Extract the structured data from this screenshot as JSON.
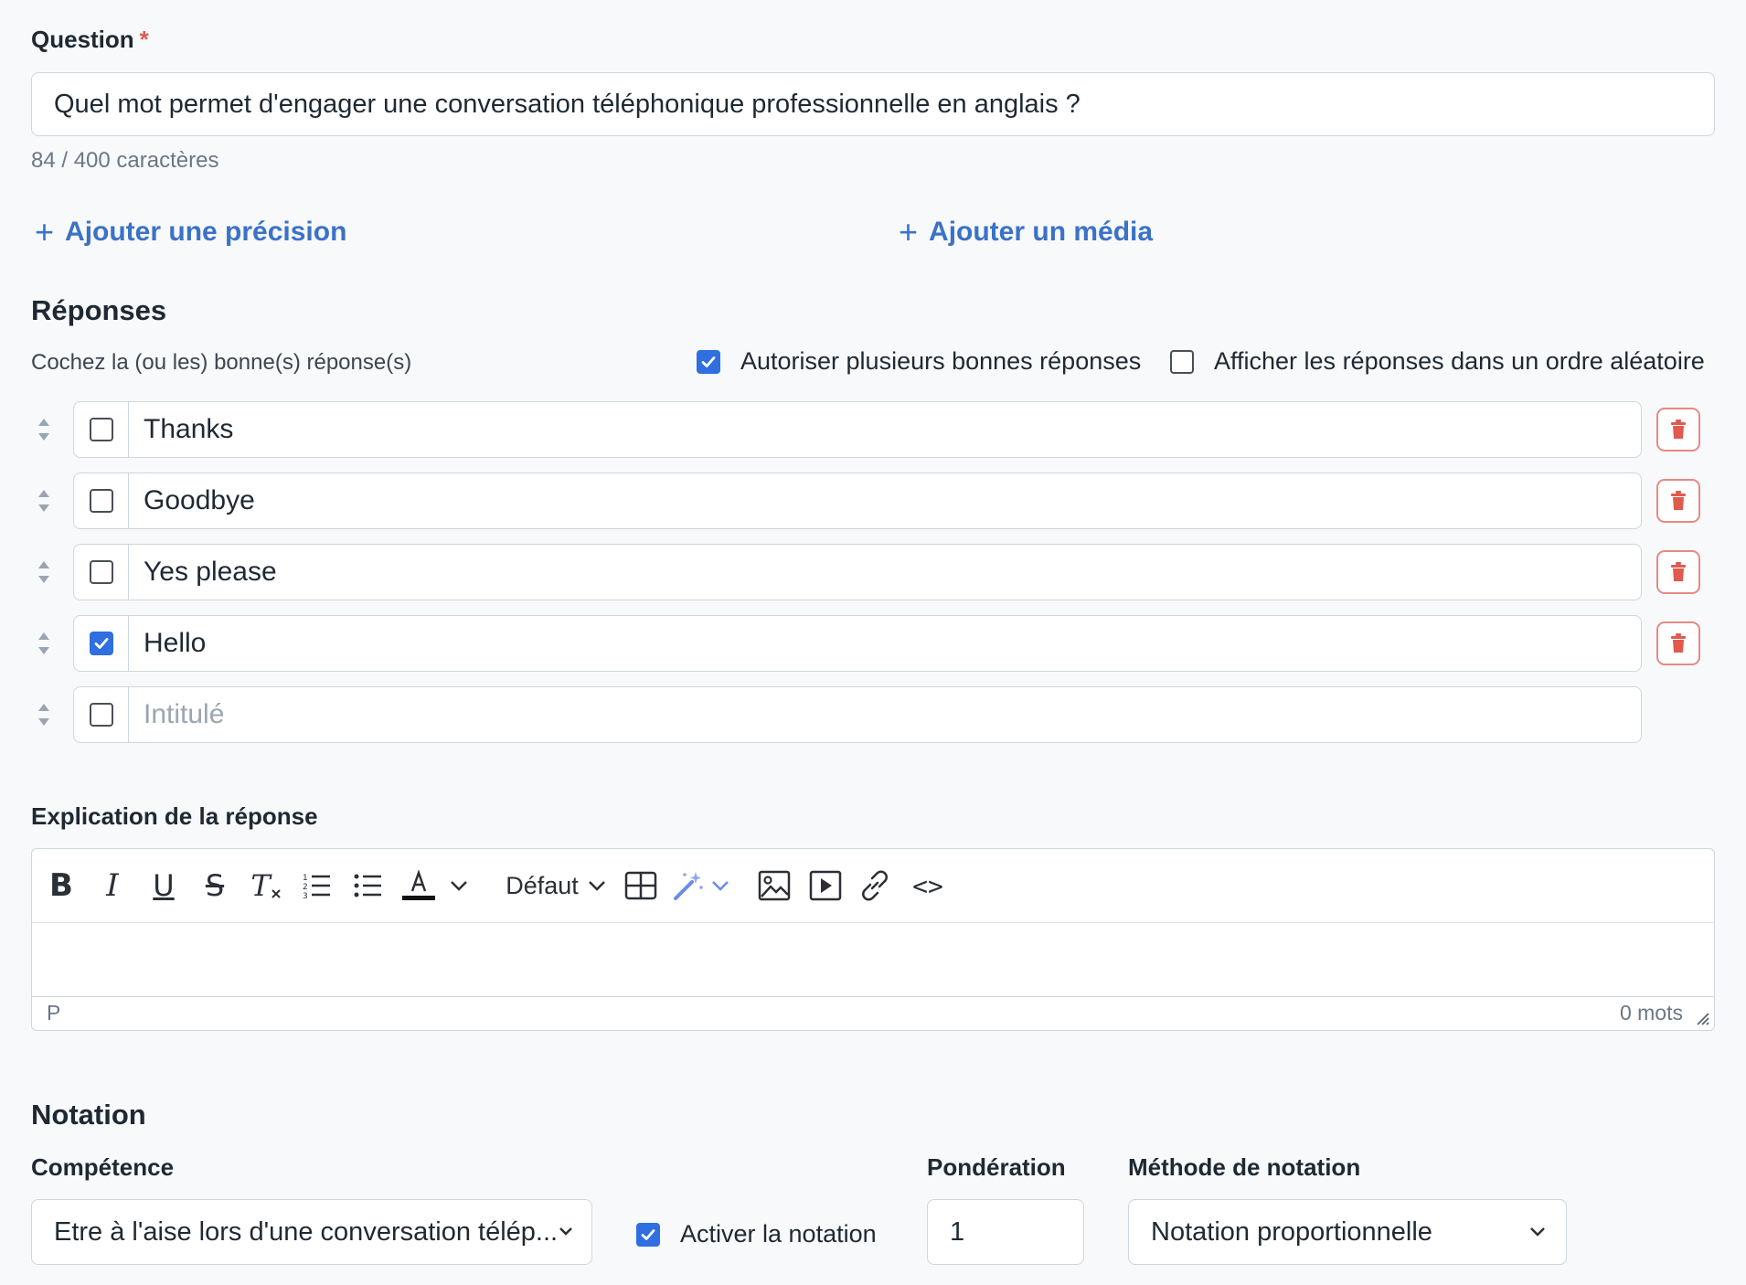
{
  "question": {
    "label": "Question",
    "required_mark": "*",
    "value": "Quel mot permet d'engager une conversation téléphonique professionnelle en anglais ?",
    "char_count": "84 / 400 caractères"
  },
  "actions": {
    "add_precision": "Ajouter une précision",
    "add_media": "Ajouter un média",
    "plus_symbol": "+"
  },
  "answers": {
    "title": "Réponses",
    "hint": "Cochez la (ou les) bonne(s) réponse(s)",
    "allow_multiple": {
      "label": "Autoriser plusieurs bonnes réponses",
      "checked": true
    },
    "random_order": {
      "label": "Afficher les réponses dans un ordre aléatoire",
      "checked": false
    },
    "items": [
      {
        "text": "Thanks",
        "checked": false
      },
      {
        "text": "Goodbye",
        "checked": false
      },
      {
        "text": "Yes please",
        "checked": false
      },
      {
        "text": "Hello",
        "checked": true
      }
    ],
    "new_placeholder": "Intitulé"
  },
  "explanation": {
    "label": "Explication de la réponse",
    "toolbar": {
      "bold": "B",
      "italic": "I",
      "underline": "U",
      "strike": "S",
      "clear_format": "T",
      "font_default": "Défaut",
      "code": "<>"
    },
    "status_path": "P",
    "word_count": "0 mots"
  },
  "notation": {
    "title": "Notation",
    "competence_label": "Compétence",
    "competence_value": "Etre à l'aise lors d'une conversation télép...",
    "activate_label": "Activer la notation",
    "activate_checked": true,
    "weight_label": "Pondération",
    "weight_value": "1",
    "method_label": "Méthode de notation",
    "method_value": "Notation proportionnelle"
  },
  "colors": {
    "accent": "#3b72c8",
    "checkbox": "#2f6fe0",
    "danger": "#e05a4e",
    "background": "#f7f9fb"
  }
}
